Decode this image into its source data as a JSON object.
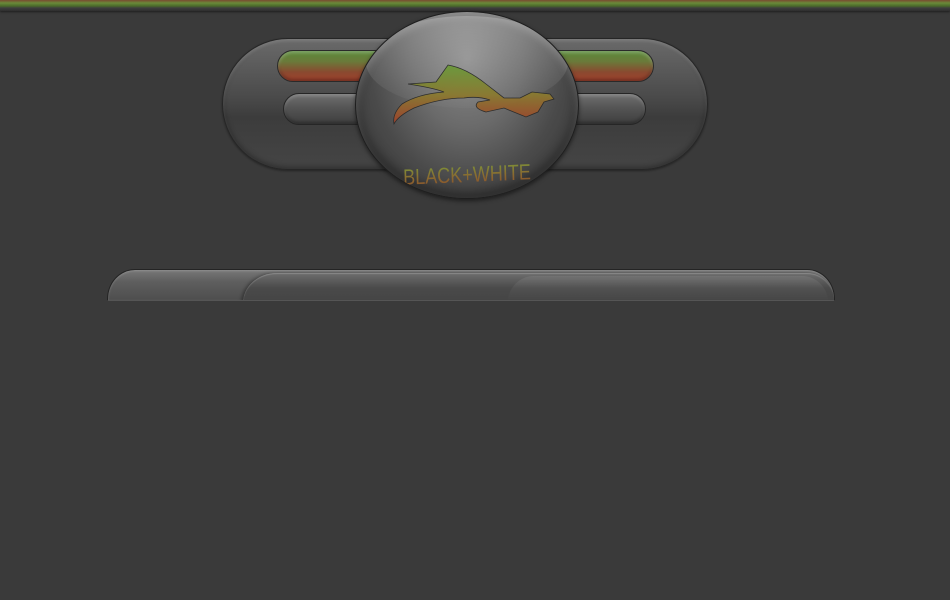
{
  "logo": {
    "text": "BLACK+WHITE",
    "icon": "bird-head-icon"
  },
  "colors": {
    "background": "#3a3a3a",
    "accent_green": "#6a8a3a",
    "accent_red": "#a0402c"
  }
}
